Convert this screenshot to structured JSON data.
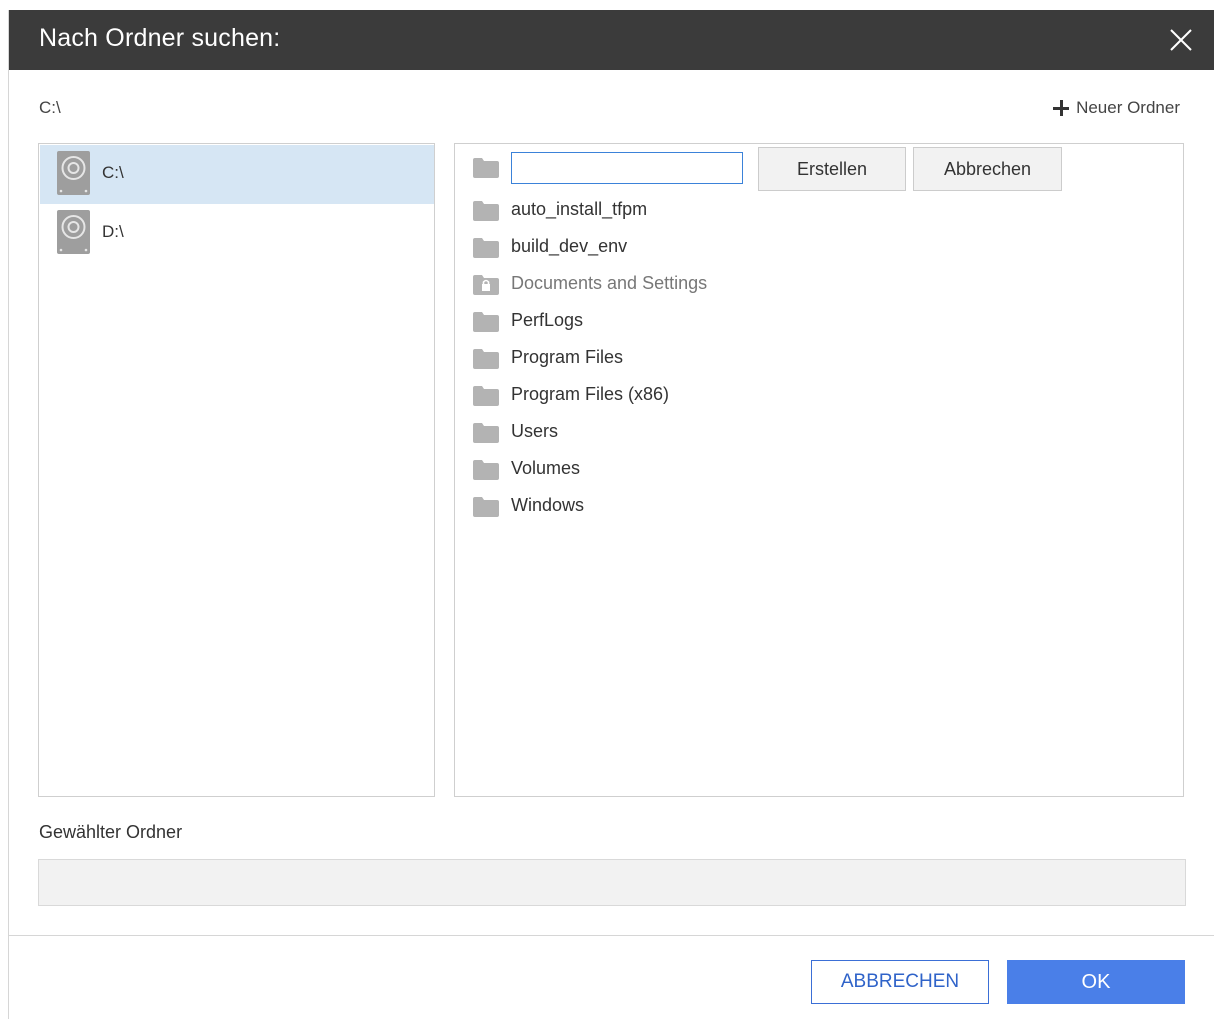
{
  "dialog": {
    "title": "Nach Ordner suchen:",
    "current_path": "C:\\",
    "new_folder_label": "Neuer Ordner"
  },
  "drives": [
    {
      "label": "C:\\",
      "selected": true
    },
    {
      "label": "D:\\",
      "selected": false
    }
  ],
  "new_folder_row": {
    "input_value": "",
    "create_label": "Erstellen",
    "cancel_label": "Abbrechen"
  },
  "folders": [
    {
      "name": "auto_install_tfpm",
      "locked": false
    },
    {
      "name": "build_dev_env",
      "locked": false
    },
    {
      "name": "Documents and Settings",
      "locked": true
    },
    {
      "name": "PerfLogs",
      "locked": false
    },
    {
      "name": "Program Files",
      "locked": false
    },
    {
      "name": "Program Files (x86)",
      "locked": false
    },
    {
      "name": "Users",
      "locked": false
    },
    {
      "name": "Volumes",
      "locked": false
    },
    {
      "name": "Windows",
      "locked": false
    }
  ],
  "selected_folder": {
    "label": "Gewählter Ordner",
    "value": ""
  },
  "footer": {
    "cancel_label": "ABBRECHEN",
    "ok_label": "OK"
  },
  "colors": {
    "titlebar": "#3b3b3b",
    "selection": "#d6e6f4",
    "primary": "#4a7fe8",
    "folder_icon": "#b3b3b3"
  }
}
